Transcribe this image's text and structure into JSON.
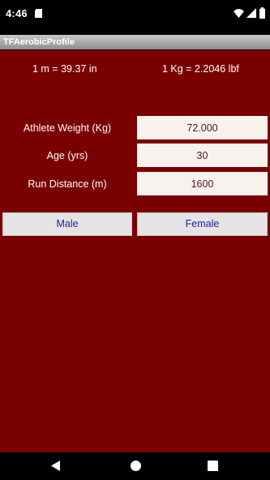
{
  "status_bar": {
    "time": "4:46",
    "icons": [
      "sd-card-icon",
      "wifi-icon",
      "signal-icon",
      "battery-icon"
    ]
  },
  "app": {
    "title": "TFAerobicProfile"
  },
  "conversions": {
    "length": "1 m = 39.37 in",
    "mass": "1 Kg = 2.2046 lbf"
  },
  "form": {
    "weight_label": "Athlete Weight (Kg)",
    "weight_value": "72.000",
    "age_label": "Age (yrs)",
    "age_value": "30",
    "distance_label": "Run Distance (m)",
    "distance_value": "1600"
  },
  "buttons": {
    "male": "Male",
    "female": "Female"
  },
  "navigation": {
    "icons": [
      "back-icon",
      "home-icon",
      "recents-icon"
    ]
  },
  "colors": {
    "background": "#7a0000",
    "field_bg": "#f8f2ef",
    "button_text": "#1f1fa0"
  }
}
